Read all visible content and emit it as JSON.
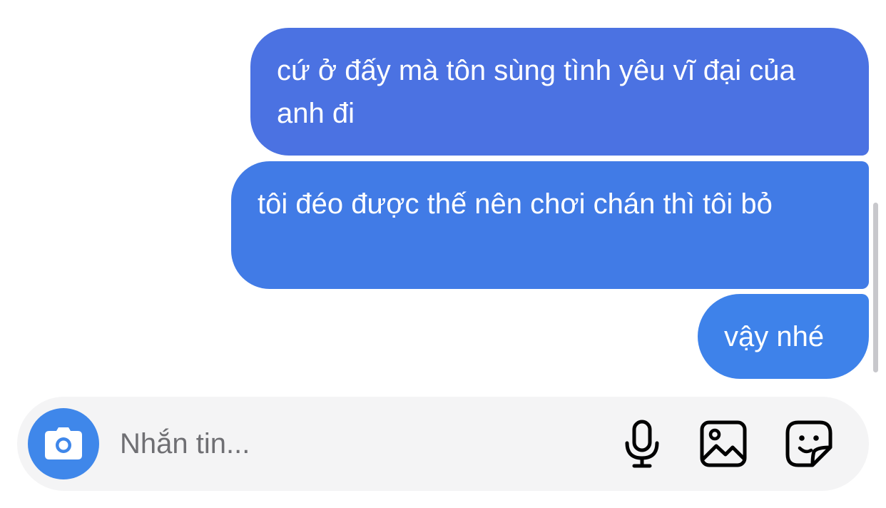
{
  "messages": [
    {
      "text": "cứ ở đấy mà tôn sùng tình yêu vĩ đại của anh đi",
      "sender": "me"
    },
    {
      "text": "tôi đéo được thế nên chơi chán thì tôi bỏ",
      "sender": "me"
    },
    {
      "text": "vậy nhé",
      "sender": "me"
    }
  ],
  "composer": {
    "placeholder": "Nhắn tin...",
    "value": "",
    "icons": {
      "camera": "camera-icon",
      "mic": "microphone-icon",
      "gallery": "image-icon",
      "sticker": "sticker-icon"
    }
  },
  "colors": {
    "bubble_top": "#4b72e2",
    "bubble_mid": "#417be6",
    "bubble_bottom": "#3e82ea",
    "camera_button": "#3f87ea",
    "composer_bg": "#f4f4f5",
    "placeholder": "#6f6f73"
  }
}
